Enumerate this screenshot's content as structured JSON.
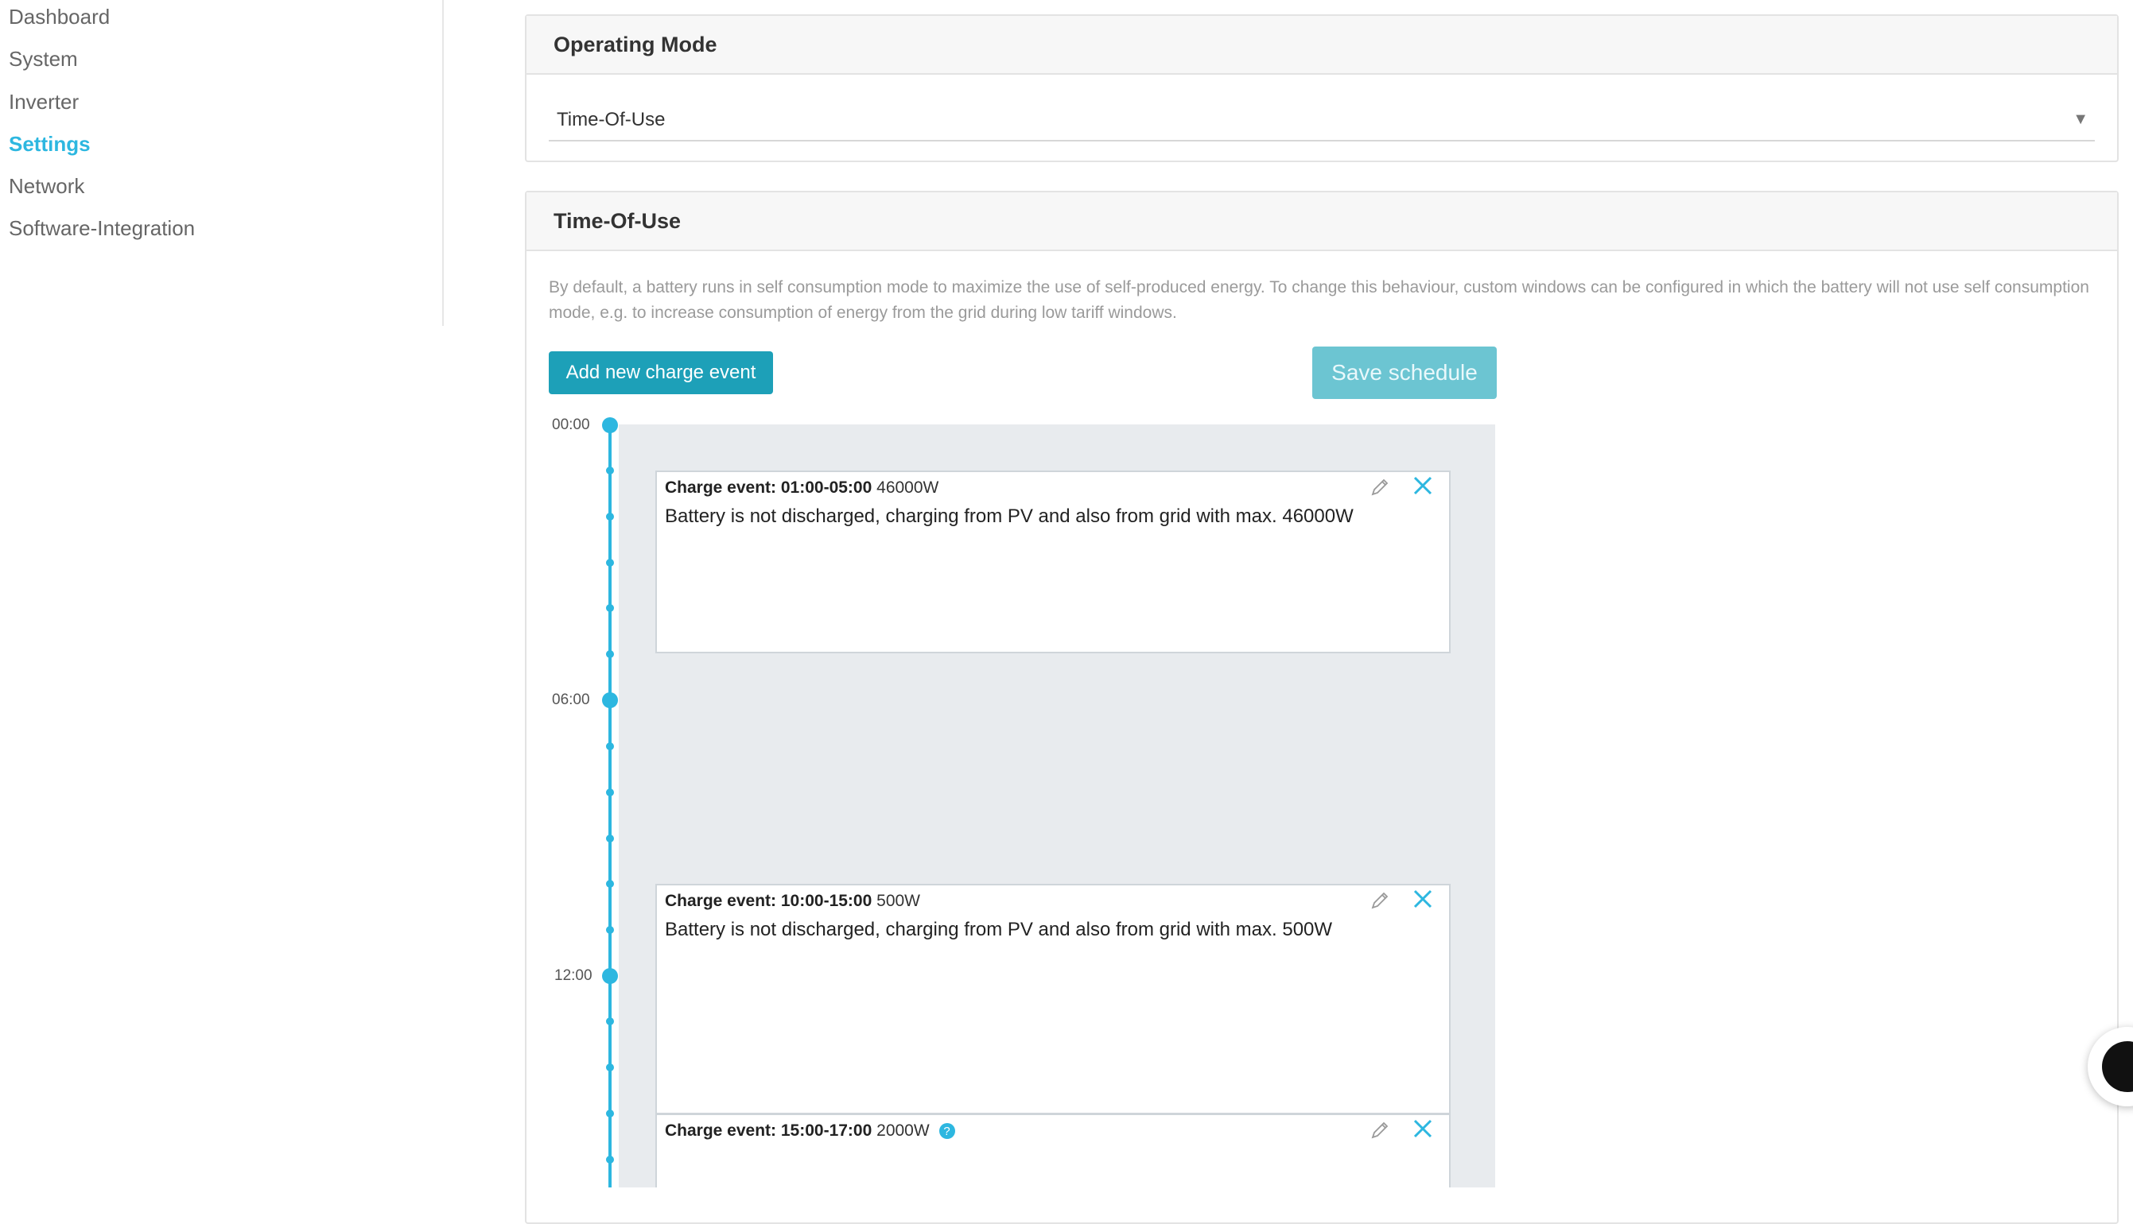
{
  "sidebar": {
    "items": [
      {
        "label": "Dashboard"
      },
      {
        "label": "System"
      },
      {
        "label": "Inverter"
      },
      {
        "label": "Settings"
      },
      {
        "label": "Network"
      },
      {
        "label": "Software-Integration"
      }
    ],
    "active": "Settings",
    "accent_color": "#2db7e0"
  },
  "operating_mode": {
    "title": "Operating Mode",
    "selected": "Time-Of-Use",
    "arrow": "▼"
  },
  "tou": {
    "title": "Time-Of-Use",
    "description": "By default, a battery runs in self consumption mode to maximize the use of self-produced energy. To change this behaviour, custom windows can be configured in which the battery will not use self consumption mode, e.g. to increase consumption of energy from the grid during low tariff windows.",
    "add_button": "Add new charge event",
    "save_button": "Save schedule",
    "timeline_labels": [
      "00:00",
      "06:00",
      "12:00"
    ],
    "events": [
      {
        "title": "Charge event: 01:00-05:00",
        "power": "46000W",
        "text": "Battery is not discharged, charging from PV and also from grid with max. 46000W"
      },
      {
        "title": "Charge event: 10:00-15:00",
        "power": "500W",
        "text": "Battery is not discharged, charging from PV and also from grid with max. 500W"
      },
      {
        "title": "Charge event: 15:00-17:00",
        "power": "2000W",
        "help": "?"
      }
    ],
    "colors": {
      "add_button": "#1da0b8",
      "save_button": "#6cc5d2",
      "timeline": "#2db7e0",
      "schedule_bg": "#e8ebee"
    }
  }
}
